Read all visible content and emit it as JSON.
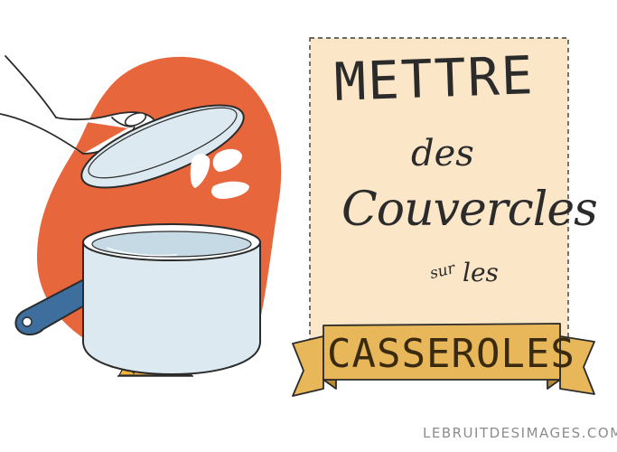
{
  "title": {
    "line1": "METTRE",
    "line2": "des",
    "line3": "Couvercles",
    "line4a": "sur",
    "line4b": "les"
  },
  "banner": {
    "label": "CASSEROLES"
  },
  "credit": "LEBRUITDESIMAGES.COM",
  "colors": {
    "orange_blob": "#E8663C",
    "parchment": "#FBE6C8",
    "banner_gold": "#E7B75A",
    "banner_fold": "#B98A36",
    "pot_body": "#DDE9F0",
    "water": "#C6DAE6",
    "handle_blue": "#3D6E9E",
    "flame": "#F3B43C",
    "ink": "#2B2B2B"
  },
  "icons": [
    "hand-icon",
    "pot-lid-icon",
    "saucepan-icon",
    "gas-flame-icon",
    "steam-marks-icon",
    "ribbon-banner-icon"
  ]
}
